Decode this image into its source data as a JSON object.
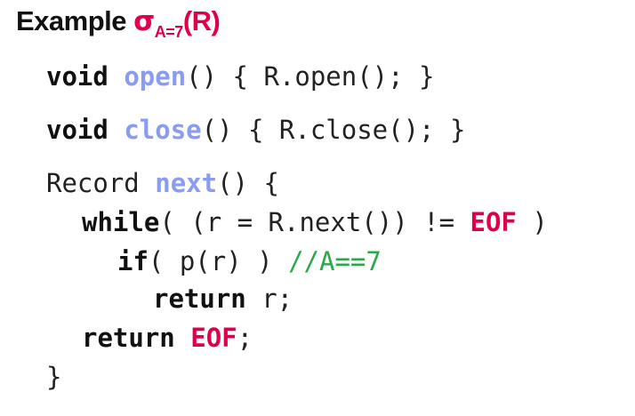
{
  "title": {
    "prefix": "Example ",
    "sigma": "σ",
    "subscript": "A=7",
    "relation": "(R)"
  },
  "code": {
    "open_kw": "void",
    "open_fn": "open",
    "open_rest": "() { R.open(); }",
    "close_kw": "void",
    "close_fn": "close",
    "close_rest": "() { R.close(); }",
    "next_type": "Record",
    "next_fn": "next",
    "next_rest": "() {",
    "while_kw": "while",
    "while_mid": "( (r = R.next()) != ",
    "while_eof": "EOF",
    "while_end": " )",
    "if_kw": "if",
    "if_mid": "( p(r) ) ",
    "if_comment": "//A==7",
    "return1_kw": "return",
    "return1_rest": " r;",
    "return2_kw": "return",
    "return2_eof": "EOF",
    "return2_end": ";",
    "closing_brace": "}"
  }
}
